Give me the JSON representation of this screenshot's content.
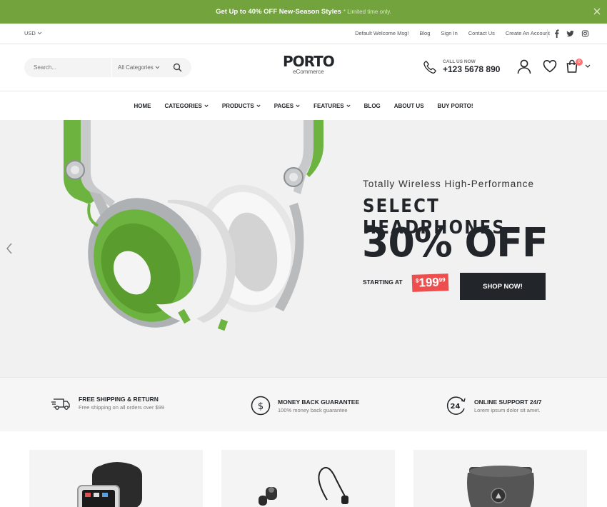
{
  "promo": {
    "prefix": "Get Up to",
    "highlight": "40% OFF",
    "suffix": "New-Season Styles",
    "note": "* Limited time only."
  },
  "topbar": {
    "currency": "USD",
    "links": [
      "Default Welcome Msg!",
      "Blog",
      "Sign In",
      "Contact Us",
      "Create An Account"
    ]
  },
  "header": {
    "search_placeholder": "Search...",
    "category_label": "All Categories",
    "logo": "PORTO",
    "logo_sub": "eCommerce",
    "call_label": "CALL US NOW",
    "phone": "+123 5678 890",
    "cart_count": "0"
  },
  "nav": [
    "HOME",
    "CATEGORIES",
    "PRODUCTS",
    "PAGES",
    "FEATURES",
    "BLOG",
    "ABOUT US",
    "BUY PORTO!"
  ],
  "hero": {
    "tagline": "Totally Wireless High-Performance",
    "headline": "SELECT HEADPHONES",
    "discount": "30% OFF",
    "starting_label": "STARTING AT",
    "price_currency": "$",
    "price_whole": "199",
    "price_cents": "99",
    "cta": "SHOP NOW!"
  },
  "features": [
    {
      "title": "FREE SHIPPING & RETURN",
      "desc": "Free shipping on all orders over $99",
      "icon": "truck-icon"
    },
    {
      "title": "MONEY BACK GUARANTEE",
      "desc": "100% money back guarantee",
      "icon": "dollar-circle-icon"
    },
    {
      "title": "ONLINE SUPPORT 24/7",
      "desc": "Lorem ipsum dolor sit amet.",
      "icon": "support-24-icon"
    }
  ],
  "colors": {
    "promo_bg": "#72a33c",
    "dark": "#222529",
    "price_red": "#ee4e4e",
    "hero_bg": "#f1f1f1"
  }
}
